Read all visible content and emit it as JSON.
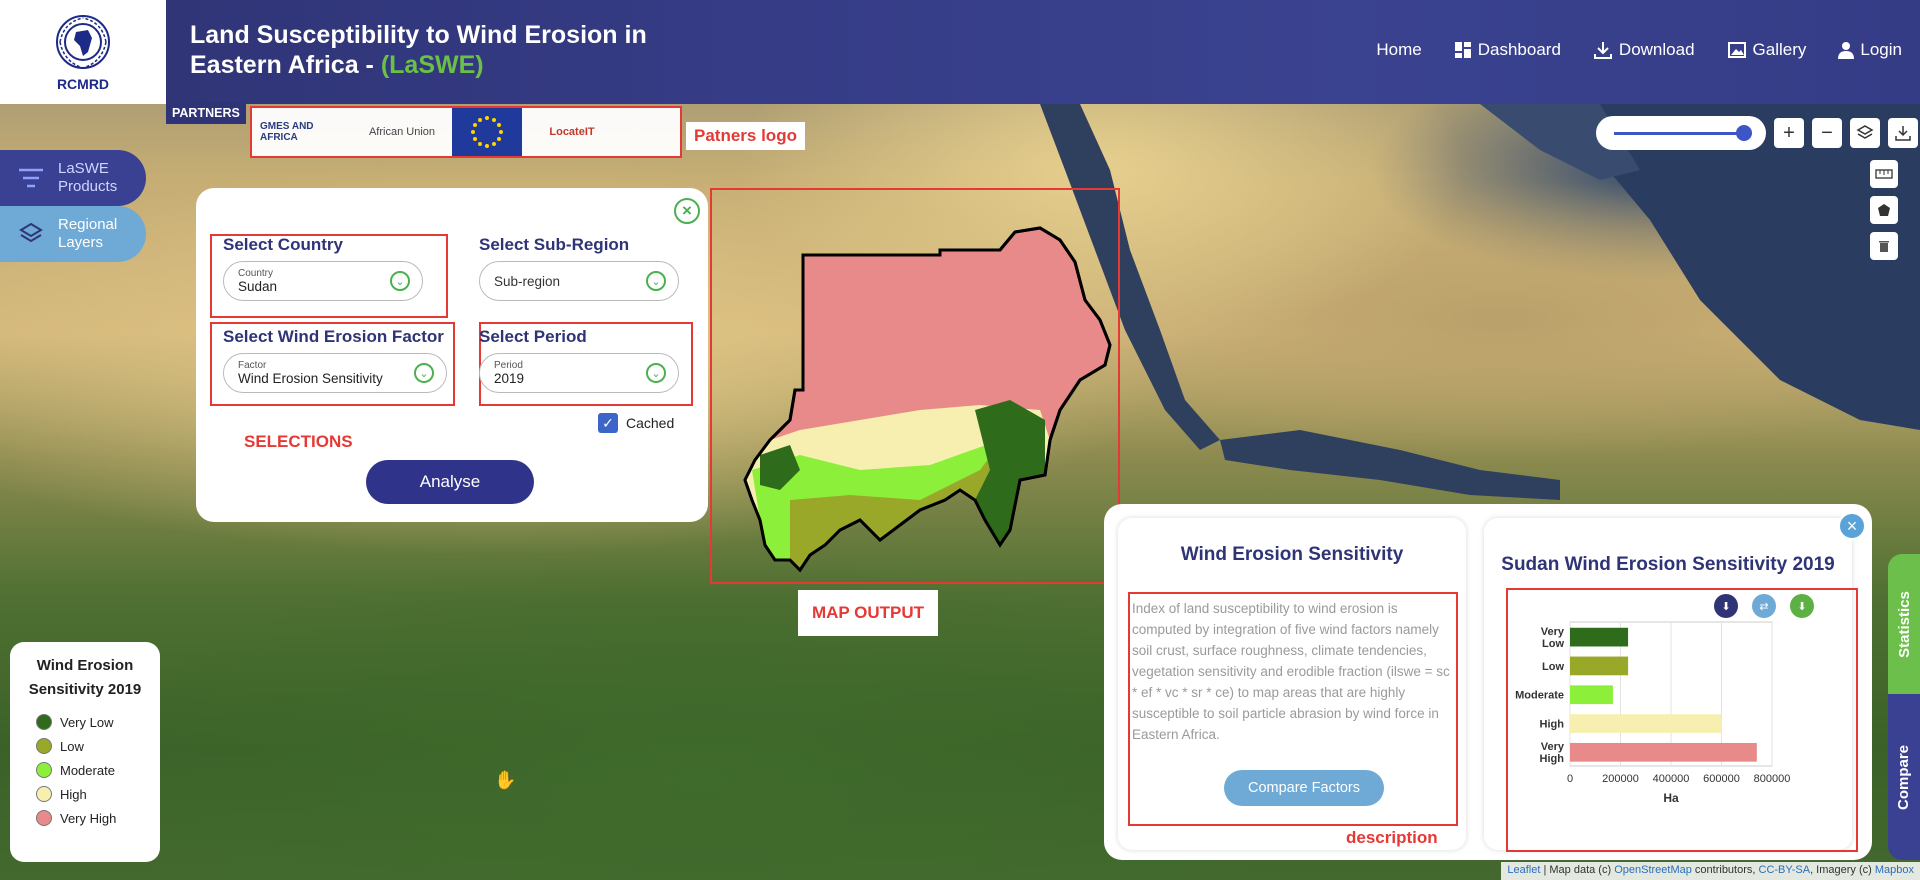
{
  "header": {
    "org": "RCMRD",
    "title_main": "Land Susceptibility to Wind Erosion in Eastern Africa - ",
    "title_accent": "(LaSWE)",
    "nav": [
      {
        "label": "Home",
        "icon": ""
      },
      {
        "label": "Dashboard",
        "icon": "dashboard-icon"
      },
      {
        "label": "Download",
        "icon": "download-icon"
      },
      {
        "label": "Gallery",
        "icon": "gallery-icon"
      },
      {
        "label": "Login",
        "icon": "user-icon"
      }
    ]
  },
  "partners": {
    "tag": "PARTNERS",
    "logos": [
      "GMES AND AFRICA",
      "African Union",
      "EU",
      "LocateIT"
    ],
    "annotation": "Patners logo"
  },
  "sidebar": {
    "products": "LaSWE Products",
    "layers": "Regional Layers"
  },
  "selection": {
    "country": {
      "title": "Select Country",
      "small": "Country",
      "value": "Sudan"
    },
    "subregion": {
      "title": "Select Sub-Region",
      "placeholder": "Sub-region"
    },
    "factor": {
      "title": "Select Wind Erosion Factor",
      "small": "Factor",
      "value": "Wind Erosion Sensitivity"
    },
    "period": {
      "title": "Select Period",
      "small": "Period",
      "value": "2019"
    },
    "cached_label": "Cached",
    "cached": true,
    "annotation": "SELECTIONS",
    "analyse_label": "Analyse"
  },
  "map": {
    "output_annotation": "MAP OUTPUT"
  },
  "legend": {
    "title": "Wind Erosion Sensitivity 2019",
    "items": [
      {
        "label": "Very Low",
        "color": "#2e6b1a"
      },
      {
        "label": "Low",
        "color": "#9aa82a"
      },
      {
        "label": "Moderate",
        "color": "#8cf03a"
      },
      {
        "label": "High",
        "color": "#f7efb0"
      },
      {
        "label": "Very High",
        "color": "#e98a8a"
      }
    ]
  },
  "description": {
    "title": "Wind Erosion Sensitivity",
    "text": "Index of land susceptibility to wind erosion is computed by integration of five wind factors namely soil crust, surface roughness, climate tendencies, vegetation sensitivity and erodible fraction (ilswe = sc * ef * vc * sr * ce) to map areas that are highly susceptible to soil particle abrasion by wind force in Eastern Africa.",
    "compare_label": "Compare Factors",
    "annotation": "description"
  },
  "chart_data": {
    "type": "bar",
    "orientation": "horizontal",
    "title": "Sudan Wind Erosion Sensitivity 2019",
    "categories": [
      "Very Low",
      "Low",
      "Moderate",
      "High",
      "Very High"
    ],
    "values": [
      230000,
      230000,
      170000,
      600000,
      740000
    ],
    "colors": [
      "#2e6b1a",
      "#9aa82a",
      "#8cf03a",
      "#f7efb0",
      "#e98a8a"
    ],
    "xlabel": "Ha",
    "xlim": [
      0,
      800000
    ],
    "xticks": [
      "0",
      "200000",
      "400000",
      "600000",
      "800000"
    ],
    "grid": true
  },
  "tabs": {
    "statistics": "Statistics",
    "compare": "Compare"
  },
  "attribution": {
    "leaflet": "Leaflet",
    "text1": " | Map data (c) ",
    "osm": "OpenStreetMap",
    "text2": " contributors, ",
    "license": "CC-BY-SA",
    "text3": ", Imagery (c) ",
    "mapbox": "Mapbox"
  }
}
